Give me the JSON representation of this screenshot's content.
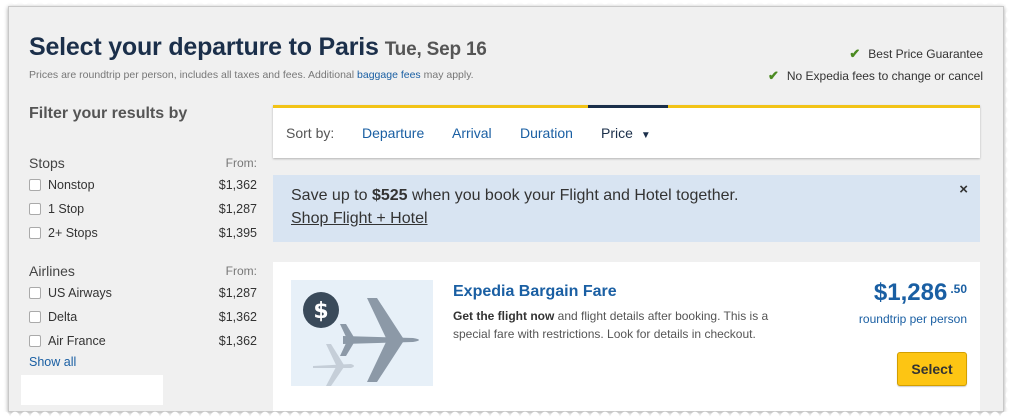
{
  "header": {
    "title": "Select your departure to Paris",
    "date": "Tue, Sep 16",
    "subtitle_pre": "Prices are roundtrip per person, includes all taxes and fees. Additional ",
    "subtitle_link": "baggage fees",
    "subtitle_post": " may apply."
  },
  "guarantees": [
    "Best Price Guarantee",
    "No Expedia fees to change or cancel"
  ],
  "filters": {
    "title": "Filter your results by",
    "stops": {
      "label": "Stops",
      "from_label": "From:",
      "options": [
        {
          "label": "Nonstop",
          "price": "$1,362",
          "checked": false
        },
        {
          "label": "1 Stop",
          "price": "$1,287",
          "checked": false
        },
        {
          "label": "2+ Stops",
          "price": "$1,395",
          "checked": false
        }
      ]
    },
    "airlines": {
      "label": "Airlines",
      "from_label": "From:",
      "options": [
        {
          "label": "US Airways",
          "price": "$1,287",
          "checked": false
        },
        {
          "label": "Delta",
          "price": "$1,362",
          "checked": false
        },
        {
          "label": "Air France",
          "price": "$1,362",
          "checked": false
        }
      ]
    },
    "show_all": "Show all"
  },
  "sort": {
    "label": "Sort by:",
    "options": [
      "Departure",
      "Arrival",
      "Duration",
      "Price"
    ],
    "active": "Price"
  },
  "banner": {
    "save_pre": "Save up to ",
    "save_amount": "$525",
    "save_post": " when you book your Flight and Hotel together.",
    "link": "Shop Flight + Hotel",
    "close": "×"
  },
  "result": {
    "title": "Expedia Bargain Fare",
    "desc_bold": "Get the flight now",
    "desc_rest": " and flight details after booking. This is a special fare with restrictions. Look for details in checkout.",
    "price_main": "$1,286",
    "price_cents": ".50",
    "price_sub": "roundtrip per person",
    "select_label": "Select"
  },
  "colors": {
    "navy": "#1b2f4a",
    "link": "#1a5fa3",
    "accent_yellow": "#f2c316",
    "button_yellow": "#fdc513",
    "check_green": "#4b8a21",
    "banner_bg": "#d8e4f2"
  }
}
